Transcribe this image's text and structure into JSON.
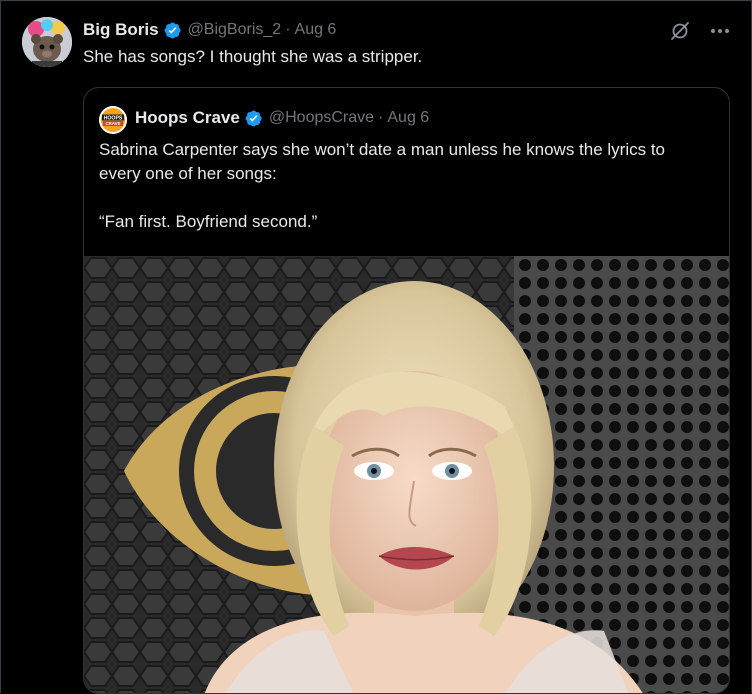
{
  "tweet": {
    "author_name": "Big Boris",
    "author_handle": "@BigBoris_2",
    "date": "Aug 6",
    "text": "She has songs? I thought she was a stripper."
  },
  "quoted_tweet": {
    "author_name": "Hoops Crave",
    "author_handle": "@HoopsCrave",
    "date": "Aug 6",
    "avatar_text_top": "HOOPS",
    "avatar_text_bottom": "CRAVE",
    "text_line1": "Sabrina Carpenter says she won’t date a man unless he knows the lyrics to every one of her songs:",
    "text_line2": "“Fan first. Boyfriend second.”"
  },
  "icons": {
    "verified": "verified-badge-icon",
    "grok": "grok-icon",
    "more": "more-icon"
  },
  "colors": {
    "background": "#000000",
    "text_primary": "#e7e9ea",
    "text_secondary": "#71767b",
    "verified_blue": "#1d9bf0",
    "border": "#2f3336"
  }
}
